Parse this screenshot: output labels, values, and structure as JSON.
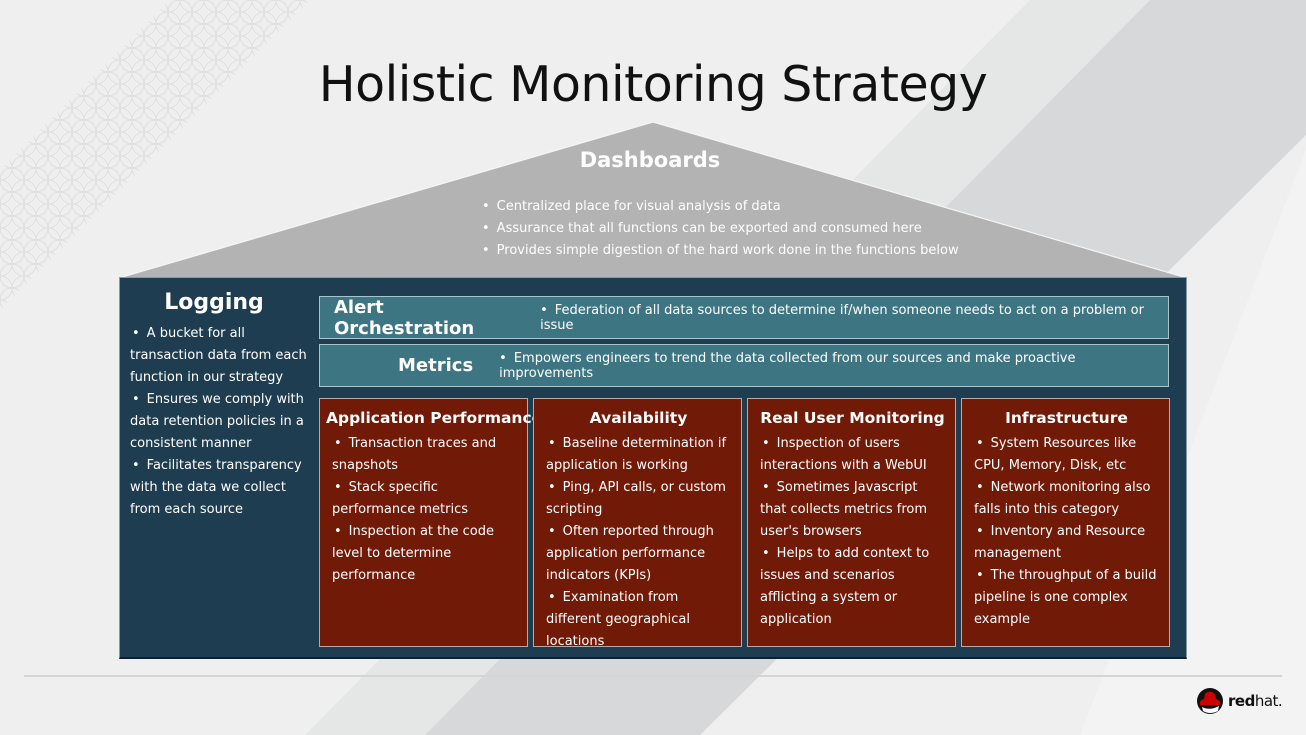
{
  "title": "Holistic Monitoring Strategy",
  "colors": {
    "roof": "#b3b3b3",
    "house": "#1f3d51",
    "band": "#3e7582",
    "pillar": "#721a08",
    "brand_red": "#cc0000"
  },
  "dashboards": {
    "heading": "Dashboards",
    "items": [
      "Centralized place for visual analysis of data",
      "Assurance that all functions can be exported and consumed here",
      "Provides simple digestion of the hard work done in the functions below"
    ]
  },
  "logging": {
    "heading": "Logging",
    "items": [
      "A bucket for all transaction data from each function in our strategy",
      "Ensures we comply with data retention policies in a consistent manner",
      "Facilitates transparency with the data we collect from each source"
    ]
  },
  "alert": {
    "heading": "Alert Orchestration",
    "text": "Federation of all data sources to determine if/when someone needs to act on a problem or issue"
  },
  "metrics": {
    "heading": "Metrics",
    "text": "Empowers engineers to trend the data collected from our sources and make proactive improvements"
  },
  "pillars": [
    {
      "heading": "Application Performance",
      "items": [
        "Transaction traces and snapshots",
        "Stack specific performance metrics",
        "Inspection at the code level to determine performance"
      ]
    },
    {
      "heading": "Availability",
      "items": [
        "Baseline determination if application is working",
        "Ping, API calls, or custom scripting",
        "Often reported through application performance indicators (KPIs)",
        "Examination from different geographical locations"
      ]
    },
    {
      "heading": "Real User Monitoring",
      "items": [
        "Inspection of users interactions with a WebUI",
        "Sometimes Javascript that collects metrics from user's browsers",
        "Helps to add context to issues and scenarios afflicting a system or application"
      ]
    },
    {
      "heading": "Infrastructure",
      "items": [
        "System Resources like CPU, Memory, Disk, etc",
        "Network monitoring also falls into this category",
        "Inventory and Resource management",
        "The throughput of a build pipeline is one complex example"
      ]
    }
  ],
  "logo": {
    "icon": "redhat-shadowman-icon",
    "word_bold": "red",
    "word_light": "hat."
  }
}
